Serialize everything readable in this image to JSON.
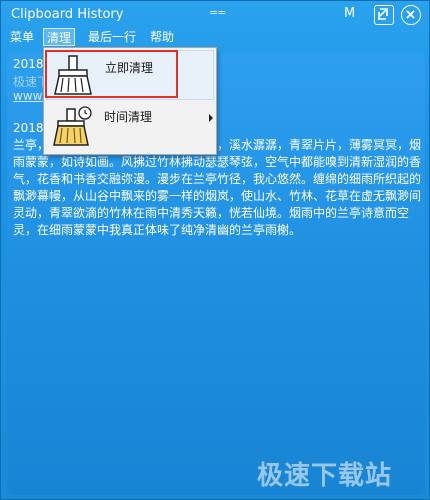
{
  "window": {
    "title": "Clipboard History",
    "drag_glyph": "==",
    "m_label": "M"
  },
  "menubar": {
    "items": [
      {
        "label": "菜单"
      },
      {
        "label": "清理"
      },
      {
        "label": "最后一行"
      },
      {
        "label": "帮助"
      }
    ]
  },
  "dropdown": {
    "items": [
      {
        "label": "立即清理",
        "icon": "broom-icon"
      },
      {
        "label": "时间清理",
        "icon": "broom-clock-icon"
      }
    ]
  },
  "entries": [
    {
      "head": "2018-",
      "line2": "极速下",
      "line3": "www."
    },
    {
      "head": "2018-",
      "body": "兰亭，江南的一方山水佳境，竹林清幽，溪水潺潺，青翠片片，薄雾冥冥，烟雨蒙蒙，如诗如画。风拂过竹林拂动瑟瑟琴弦，空气中都能嗅到清新湿润的香气，花香和书香交融弥漫。漫步在兰亭竹径，我心悠然。缠绵的细雨所织起的飘渺幕幔，从山谷中飘来的雾一样的烟岚，使山水、竹林、花草在虚无飘渺间灵动，青翠欲滴的竹林在雨中清秀天籁，恍若仙境。烟雨中的兰亭诗意而空灵，在细雨蒙蒙中我真正体味了纯净清幽的兰亭雨榭。"
    }
  ],
  "watermark": "极速下载站",
  "colors": {
    "accent": "#1a8fd9",
    "highlight_border": "#e0302a"
  }
}
